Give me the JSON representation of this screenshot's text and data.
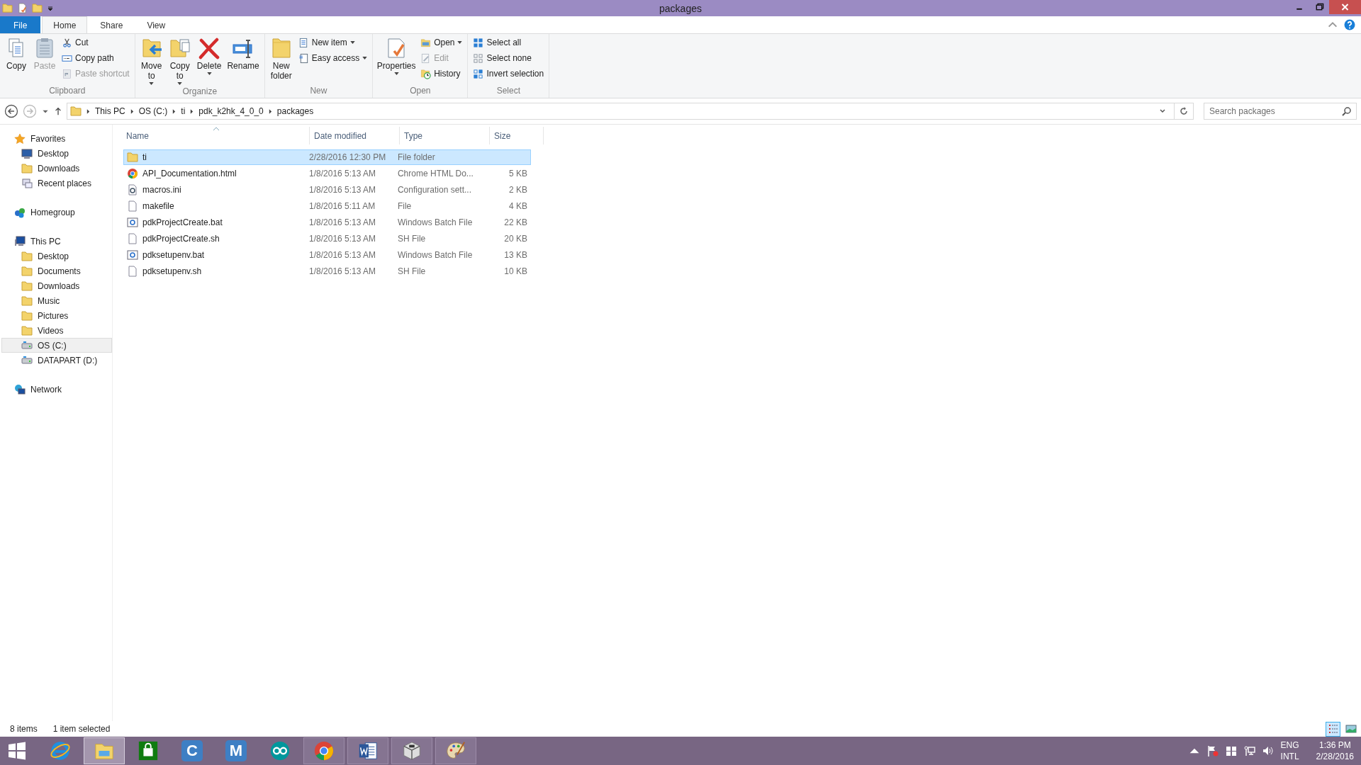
{
  "window": {
    "title": "packages"
  },
  "ribbon_tabs": [
    {
      "label": "File",
      "kind": "file",
      "selected": false
    },
    {
      "label": "Home",
      "kind": "tab",
      "selected": true
    },
    {
      "label": "Share",
      "kind": "tab",
      "selected": false
    },
    {
      "label": "View",
      "kind": "tab",
      "selected": false
    }
  ],
  "ribbon_groups": [
    {
      "name": "Clipboard",
      "items": [
        {
          "label": "Copy",
          "kind": "large",
          "disabled": false,
          "dropdown": false
        },
        {
          "label": "Paste",
          "kind": "large",
          "disabled": true,
          "dropdown": false
        },
        {
          "label": "Cut",
          "kind": "small",
          "disabled": false,
          "dropdown": false
        },
        {
          "label": "Copy path",
          "kind": "small",
          "disabled": false,
          "dropdown": false
        },
        {
          "label": "Paste shortcut",
          "kind": "small",
          "disabled": true,
          "dropdown": false
        }
      ]
    },
    {
      "name": "Organize",
      "items": [
        {
          "label": "Move to",
          "kind": "large",
          "disabled": false,
          "dropdown": true
        },
        {
          "label": "Copy to",
          "kind": "large",
          "disabled": false,
          "dropdown": true
        },
        {
          "label": "Delete",
          "kind": "large",
          "disabled": false,
          "dropdown": true
        },
        {
          "label": "Rename",
          "kind": "large",
          "disabled": false,
          "dropdown": false
        }
      ]
    },
    {
      "name": "New",
      "items": [
        {
          "label": "New folder",
          "kind": "large",
          "disabled": false,
          "dropdown": false
        },
        {
          "label": "New item",
          "kind": "small",
          "disabled": false,
          "dropdown": true
        },
        {
          "label": "Easy access",
          "kind": "small",
          "disabled": false,
          "dropdown": true
        }
      ]
    },
    {
      "name": "Open",
      "items": [
        {
          "label": "Properties",
          "kind": "large",
          "disabled": false,
          "dropdown": true
        },
        {
          "label": "Open",
          "kind": "small",
          "disabled": false,
          "dropdown": true
        },
        {
          "label": "Edit",
          "kind": "small",
          "disabled": true,
          "dropdown": false
        },
        {
          "label": "History",
          "kind": "small",
          "disabled": false,
          "dropdown": false
        }
      ]
    },
    {
      "name": "Select",
      "items": [
        {
          "label": "Select all",
          "kind": "small",
          "disabled": false,
          "dropdown": false
        },
        {
          "label": "Select none",
          "kind": "small",
          "disabled": false,
          "dropdown": false
        },
        {
          "label": "Invert selection",
          "kind": "small",
          "disabled": false,
          "dropdown": false
        }
      ]
    }
  ],
  "breadcrumb": [
    "This PC",
    "OS (C:)",
    "ti",
    "pdk_k2hk_4_0_0",
    "packages"
  ],
  "search": {
    "placeholder": "Search packages"
  },
  "sidebar": [
    {
      "label": "Favorites",
      "kind": "star",
      "selected": false,
      "children": [
        {
          "label": "Desktop",
          "kind": "desktop",
          "selected": false
        },
        {
          "label": "Downloads",
          "kind": "folder",
          "selected": false
        },
        {
          "label": "Recent places",
          "kind": "recent",
          "selected": false
        }
      ]
    },
    {
      "label": "Homegroup",
      "kind": "homegroup",
      "selected": false
    },
    {
      "label": "This PC",
      "kind": "pc",
      "selected": false,
      "children": [
        {
          "label": "Desktop",
          "kind": "folder",
          "selected": false
        },
        {
          "label": "Documents",
          "kind": "folder",
          "selected": false
        },
        {
          "label": "Downloads",
          "kind": "folder",
          "selected": false
        },
        {
          "label": "Music",
          "kind": "folder",
          "selected": false
        },
        {
          "label": "Pictures",
          "kind": "folder",
          "selected": false
        },
        {
          "label": "Videos",
          "kind": "folder",
          "selected": false
        },
        {
          "label": "OS (C:)",
          "kind": "drive",
          "selected": true
        },
        {
          "label": "DATAPART (D:)",
          "kind": "drive",
          "selected": false
        }
      ]
    },
    {
      "label": "Network",
      "kind": "network",
      "selected": false
    }
  ],
  "table": {
    "columns": [
      {
        "label": "Name",
        "sorted": true
      },
      {
        "label": "Date modified",
        "sorted": false
      },
      {
        "label": "Type",
        "sorted": false
      },
      {
        "label": "Size",
        "sorted": false
      }
    ],
    "rows": [
      {
        "kind": "folder",
        "name": "ti",
        "date": "2/28/2016 12:30 PM",
        "type": "File folder",
        "selected": true
      },
      {
        "kind": "chrome",
        "name": "API_Documentation.html",
        "date": "1/8/2016 5:13 AM",
        "type": "Chrome HTML Do...",
        "size": "5 KB",
        "selected": false
      },
      {
        "kind": "settings",
        "name": "macros.ini",
        "date": "1/8/2016 5:13 AM",
        "type": "Configuration sett...",
        "size": "2 KB",
        "selected": false
      },
      {
        "kind": "file",
        "name": "makefile",
        "date": "1/8/2016 5:11 AM",
        "type": "File",
        "size": "4 KB",
        "selected": false
      },
      {
        "kind": "batch",
        "name": "pdkProjectCreate.bat",
        "date": "1/8/2016 5:13 AM",
        "type": "Windows Batch File",
        "size": "22 KB",
        "selected": false
      },
      {
        "kind": "file",
        "name": "pdkProjectCreate.sh",
        "date": "1/8/2016 5:13 AM",
        "type": "SH File",
        "size": "20 KB",
        "selected": false
      },
      {
        "kind": "batch",
        "name": "pdksetupenv.bat",
        "date": "1/8/2016 5:13 AM",
        "type": "Windows Batch File",
        "size": "13 KB",
        "selected": false
      },
      {
        "kind": "file",
        "name": "pdksetupenv.sh",
        "date": "1/8/2016 5:13 AM",
        "type": "SH File",
        "size": "10 KB",
        "selected": false
      }
    ]
  },
  "status_bar": {
    "item_count": "8 items",
    "selection": "1 item selected"
  },
  "view_buttons": [
    {
      "kind": "details",
      "selected": true
    },
    {
      "kind": "large",
      "selected": false
    }
  ],
  "taskbar": {
    "apps": [
      {
        "kind": "ie",
        "running": false,
        "active": false
      },
      {
        "kind": "explorer",
        "running": true,
        "active": true
      },
      {
        "kind": "store",
        "running": false,
        "active": false
      },
      {
        "kind": "letter",
        "label": "C",
        "running": false,
        "active": false
      },
      {
        "kind": "letter",
        "label": "M",
        "running": false,
        "active": false
      },
      {
        "kind": "arduino",
        "running": false,
        "active": false
      },
      {
        "kind": "chrome",
        "running": true,
        "active": false
      },
      {
        "kind": "word",
        "running": true,
        "active": false
      },
      {
        "kind": "cube",
        "running": true,
        "active": false
      },
      {
        "kind": "paint",
        "running": true,
        "active": false
      }
    ],
    "language": [
      "ENG",
      "INTL"
    ],
    "time": "1:36 PM",
    "date": "2/28/2016"
  }
}
